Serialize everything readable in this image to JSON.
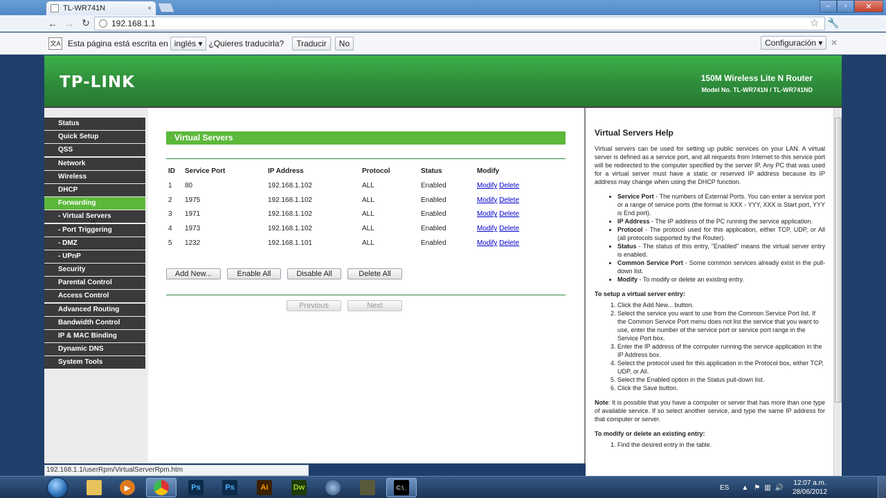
{
  "browser": {
    "tab_title": "TL-WR741N",
    "tab_close": "×",
    "window_controls": [
      "–",
      "▫",
      "✕"
    ],
    "url": "192.168.1.1",
    "nav": {
      "back": "←",
      "forward": "→",
      "reload": "↻"
    }
  },
  "translate_bar": {
    "message": "Esta página está escrita en",
    "language": "inglés",
    "question": "¿Quieres traducirla?",
    "translate_button": "Traducir",
    "no_button": "No",
    "config_button": "Configuración",
    "close": "✕"
  },
  "header": {
    "logo": "TP-LINK",
    "product": "150M Wireless Lite N Router",
    "model": "Model No. TL-WR741N / TL-WR741ND"
  },
  "sidebar": {
    "items": [
      {
        "label": "Status"
      },
      {
        "label": "Quick Setup"
      },
      {
        "label": "QSS"
      },
      {
        "label": "Network"
      },
      {
        "label": "Wireless"
      },
      {
        "label": "DHCP"
      },
      {
        "label": "Forwarding"
      },
      {
        "label": "- Virtual Servers"
      },
      {
        "label": "- Port Triggering"
      },
      {
        "label": "- DMZ"
      },
      {
        "label": "- UPnP"
      },
      {
        "label": "Security"
      },
      {
        "label": "Parental Control"
      },
      {
        "label": "Access Control"
      },
      {
        "label": "Advanced Routing"
      },
      {
        "label": "Bandwidth Control"
      },
      {
        "label": "IP & MAC Binding"
      },
      {
        "label": "Dynamic DNS"
      },
      {
        "label": "System Tools"
      }
    ]
  },
  "main": {
    "title": "Virtual Servers",
    "columns": [
      "ID",
      "Service Port",
      "IP Address",
      "Protocol",
      "Status",
      "Modify"
    ],
    "rows": [
      {
        "id": "1",
        "port": "80",
        "ip": "192.168.1.102",
        "protocol": "ALL",
        "status": "Enabled"
      },
      {
        "id": "2",
        "port": "1975",
        "ip": "192.168.1.102",
        "protocol": "ALL",
        "status": "Enabled"
      },
      {
        "id": "3",
        "port": "1971",
        "ip": "192.168.1.102",
        "protocol": "ALL",
        "status": "Enabled"
      },
      {
        "id": "4",
        "port": "1973",
        "ip": "192.168.1.102",
        "protocol": "ALL",
        "status": "Enabled"
      },
      {
        "id": "5",
        "port": "1232",
        "ip": "192.168.1.101",
        "protocol": "ALL",
        "status": "Enabled"
      }
    ],
    "modify_label": "Modify",
    "delete_label": "Delete",
    "buttons": {
      "add_new": "Add New...",
      "enable_all": "Enable All",
      "disable_all": "Disable All",
      "delete_all": "Delete All",
      "previous": "Previous",
      "next": "Next"
    }
  },
  "help": {
    "title": "Virtual Servers Help",
    "intro": "Virtual servers can be used for setting up public services on your LAN. A virtual server is defined as a service port, and all requests from Internet to this service port will be redirected to the computer specified by the server IP. Any PC that was used for a virtual server must have a static or reserved IP address because its IP address may change when using the DHCP function.",
    "fields": [
      {
        "term": "Service Port",
        "text": " - The numbers of External Ports. You can enter a service port or a range of service ports (the format is XXX - YYY, XXX is Start port, YYY is End port)."
      },
      {
        "term": "IP Address",
        "text": " - The IP address of the PC running the service application."
      },
      {
        "term": "Protocol",
        "text": " - The protocol used for this application, either TCP, UDP, or All (all protocols supported by the Router)."
      },
      {
        "term": "Status",
        "text": " - The status of this entry, \"Enabled\" means the virtual server entry is enabled."
      },
      {
        "term": "Common Service Port",
        "text": " - Some common services already exist in the pull-down list."
      },
      {
        "term": "Modify",
        "text": " - To modify or delete an existing entry."
      }
    ],
    "setup_heading": "To setup a virtual server entry:",
    "setup_steps": [
      "Click the Add New... button.",
      "Select the service you want to use from the Common Service Port list. If the Common Service Port menu does not list the service that you want to use, enter the number of the service port or service port range in the Service Port box.",
      "Enter the IP address of the computer running the service application in the IP Address box.",
      "Select the protocol used for this application in the Protocol box, either TCP, UDP, or All.",
      "Select the Enabled option in the Status pull-down list.",
      "Click the Save button."
    ],
    "note_label": "Note",
    "note": ": It is possible that you have a computer or server that has more than one type of available service. If so select another service, and type the same IP address for that computer or server.",
    "modify_heading": "To modify or delete an existing entry:",
    "modify_steps": [
      "Find the desired entry in the table."
    ]
  },
  "status_bar": {
    "url": "192.168.1.1/userRpm/VirtualServerRpm.htm"
  },
  "taskbar": {
    "apps": [
      "Ps",
      "Ps",
      "Ai",
      "Dw"
    ],
    "language": "ES",
    "time": "12:07 a.m.",
    "date": "28/06/2012"
  }
}
